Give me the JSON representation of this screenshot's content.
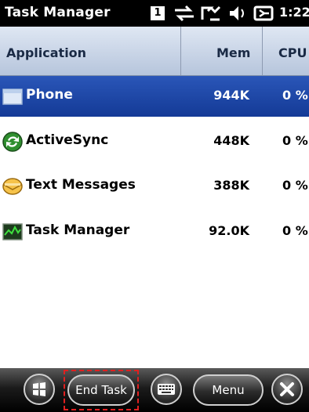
{
  "status_bar": {
    "title": "Task Manager",
    "sim_slot": "1",
    "time": "1:22",
    "icons": [
      "sync-arrows-icon",
      "signal-icon",
      "volume-icon",
      "battery-icon"
    ]
  },
  "columns": {
    "application": "Application",
    "mem": "Mem",
    "cpu": "CPU"
  },
  "rows": [
    {
      "name": "Phone",
      "mem": "944K",
      "cpu": "0 %",
      "icon": "phone-app-icon",
      "selected": true
    },
    {
      "name": "ActiveSync",
      "mem": "448K",
      "cpu": "0 %",
      "icon": "activesync-icon",
      "selected": false
    },
    {
      "name": "Text Messages",
      "mem": "388K",
      "cpu": "0 %",
      "icon": "messages-icon",
      "selected": false
    },
    {
      "name": "Task Manager",
      "mem": "92.0K",
      "cpu": "0 %",
      "icon": "task-manager-icon",
      "selected": false
    }
  ],
  "bottom_bar": {
    "end_task_label": "End Task",
    "menu_label": "Menu",
    "icons": [
      "windows-start-icon",
      "keyboard-icon",
      "close-icon"
    ]
  },
  "colors": {
    "selection": "#1f4aa8",
    "header": "#c3d0e3",
    "highlight_box": "#e02020"
  }
}
